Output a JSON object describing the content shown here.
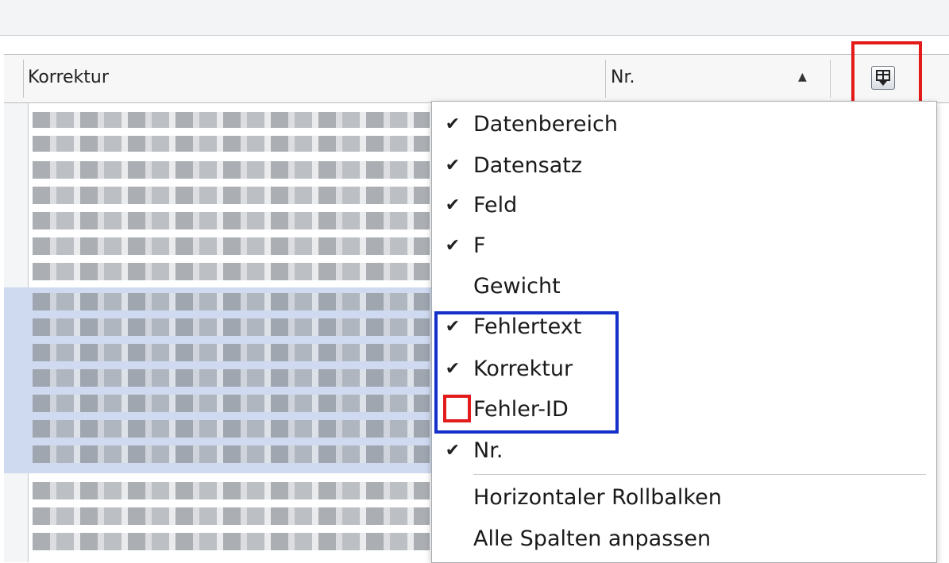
{
  "header": {
    "columns": [
      {
        "label": "Korrektur"
      },
      {
        "label": "Nr."
      }
    ],
    "sort_indicator": "ascending"
  },
  "column_picker": {
    "icon": "column-chooser-icon",
    "highlight_color": "#e31b1b"
  },
  "context_menu": {
    "items": [
      {
        "label": "Datenbereich",
        "checked": true
      },
      {
        "label": "Datensatz",
        "checked": true
      },
      {
        "label": "Feld",
        "checked": true
      },
      {
        "label": "F",
        "checked": true
      },
      {
        "label": "Gewicht",
        "checked": false
      },
      {
        "label": "Fehlertext",
        "checked": true
      },
      {
        "label": "Korrektur",
        "checked": true
      },
      {
        "label": "Fehler-ID",
        "checked": false
      },
      {
        "label": "Nr.",
        "checked": true
      }
    ],
    "actions": [
      {
        "label": "Horizontaler Rollbalken"
      },
      {
        "label": "Alle Spalten anpassen"
      }
    ],
    "highlight_group_color": "#1430c8",
    "highlight_item_color": "#e31b1b"
  }
}
